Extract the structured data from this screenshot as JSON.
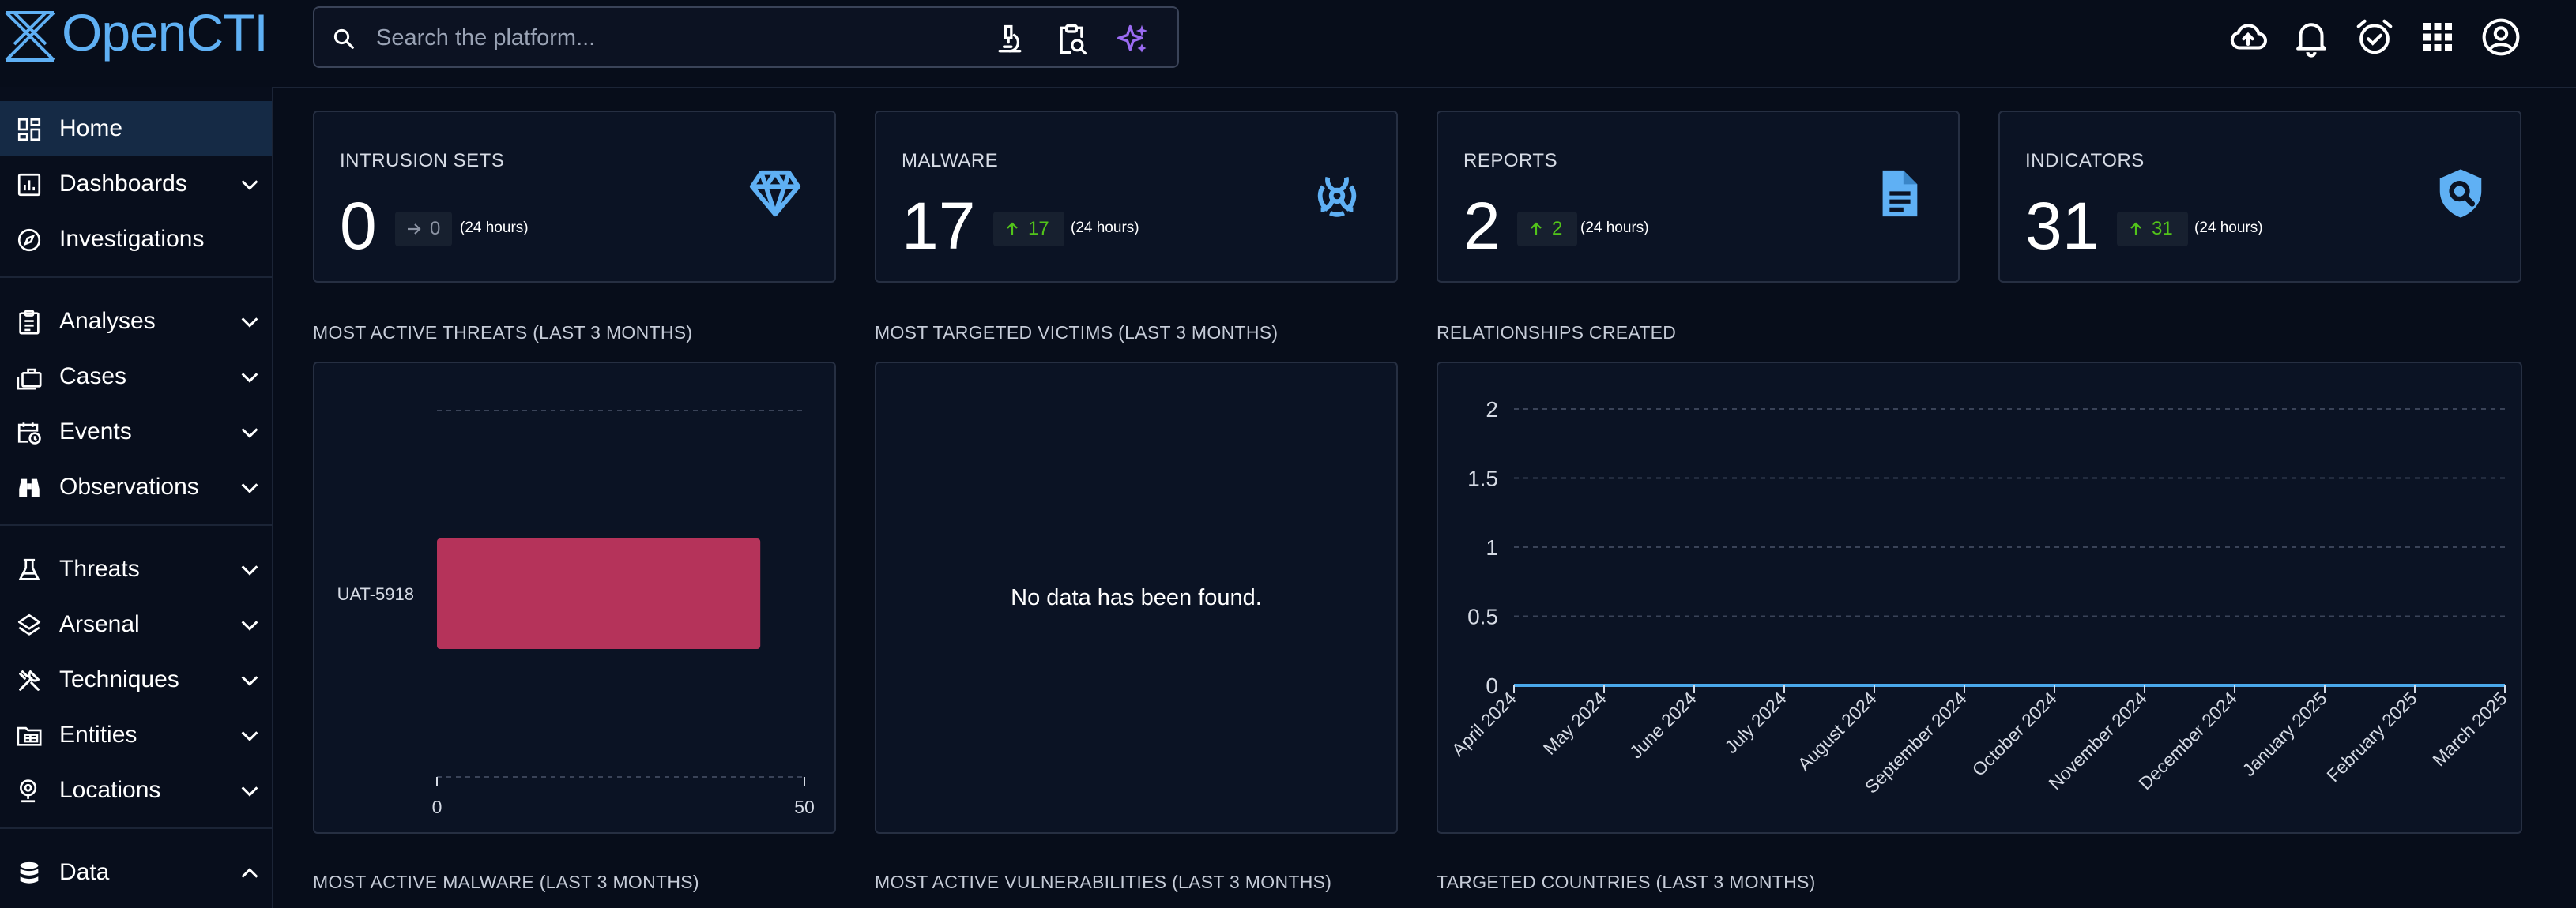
{
  "app": {
    "brand": "OpenCTI"
  },
  "search": {
    "placeholder": "Search the platform..."
  },
  "header_icons": [
    "cloud-upload-icon",
    "notifications-icon",
    "alarm-icon",
    "apps-icon",
    "account-icon"
  ],
  "sidebar": {
    "items": [
      {
        "label": "Home",
        "icon": "dashboard-icon",
        "active": true
      },
      {
        "label": "Dashboards",
        "icon": "chart-icon",
        "expandable": true
      },
      {
        "label": "Investigations",
        "icon": "compass-icon"
      },
      {
        "label": "Analyses",
        "icon": "clipboard-icon",
        "expandable": true
      },
      {
        "label": "Cases",
        "icon": "briefcase-icon",
        "expandable": true
      },
      {
        "label": "Events",
        "icon": "calendar-clock-icon",
        "expandable": true
      },
      {
        "label": "Observations",
        "icon": "binoculars-icon",
        "expandable": true
      },
      {
        "label": "Threats",
        "icon": "flask-icon",
        "expandable": true
      },
      {
        "label": "Arsenal",
        "icon": "layers-icon",
        "expandable": true
      },
      {
        "label": "Techniques",
        "icon": "tools-icon",
        "expandable": true
      },
      {
        "label": "Entities",
        "icon": "folder-table-icon",
        "expandable": true
      },
      {
        "label": "Locations",
        "icon": "map-pin-icon",
        "expandable": true
      },
      {
        "label": "Data",
        "icon": "database-icon",
        "expandable": true,
        "expanded": true
      }
    ]
  },
  "kpis": [
    {
      "title": "INTRUSION SETS",
      "value": "0",
      "delta": "0",
      "trend": "flat",
      "period": "(24 hours)",
      "icon": "diamond-icon"
    },
    {
      "title": "MALWARE",
      "value": "17",
      "delta": "17",
      "trend": "up",
      "period": "(24 hours)",
      "icon": "biohazard-icon"
    },
    {
      "title": "REPORTS",
      "value": "2",
      "delta": "2",
      "trend": "up",
      "period": "(24 hours)",
      "icon": "document-icon"
    },
    {
      "title": "INDICATORS",
      "value": "31",
      "delta": "31",
      "trend": "up",
      "period": "(24 hours)",
      "icon": "shield-search-icon"
    }
  ],
  "widgets": {
    "threats": {
      "title": "MOST ACTIVE THREATS (LAST 3 MONTHS)",
      "chart_data": {
        "type": "bar",
        "orientation": "horizontal",
        "categories": [
          "UAT-5918"
        ],
        "values": [
          44
        ],
        "xlim": [
          0,
          50
        ],
        "x_ticks": [
          "0",
          "50"
        ],
        "grid": true,
        "color": "#b5335a"
      }
    },
    "victims": {
      "title": "MOST TARGETED VICTIMS (LAST 3 MONTHS)",
      "empty_message": "No data has been found."
    },
    "relationships": {
      "title": "RELATIONSHIPS CREATED",
      "chart_data": {
        "type": "line",
        "x": [
          "April 2024",
          "May 2024",
          "June 2024",
          "July 2024",
          "August 2024",
          "September 2024",
          "October 2024",
          "November 2024",
          "December 2024",
          "January 2025",
          "February 2025",
          "March 2025"
        ],
        "series": [
          {
            "values": [
              0,
              0,
              0,
              0,
              0,
              0,
              0,
              0,
              0,
              0,
              0,
              0
            ]
          }
        ],
        "ylim": [
          0,
          2
        ],
        "y_ticks": [
          "0",
          "0.5",
          "1",
          "1.5",
          "2"
        ],
        "grid": true,
        "color": "#4aa8ea"
      }
    },
    "malware_title": "MOST ACTIVE MALWARE (LAST 3 MONTHS)",
    "vulnerabilities_title": "MOST ACTIVE VULNERABILITIES (LAST 3 MONTHS)",
    "countries_title": "TARGETED COUNTRIES (LAST 3 MONTHS)"
  },
  "colors": {
    "accent": "#5fb0f4",
    "up": "#52c41a",
    "flat": "#8b93a3",
    "bar": "#b5335a",
    "line": "#4aa8ea"
  }
}
